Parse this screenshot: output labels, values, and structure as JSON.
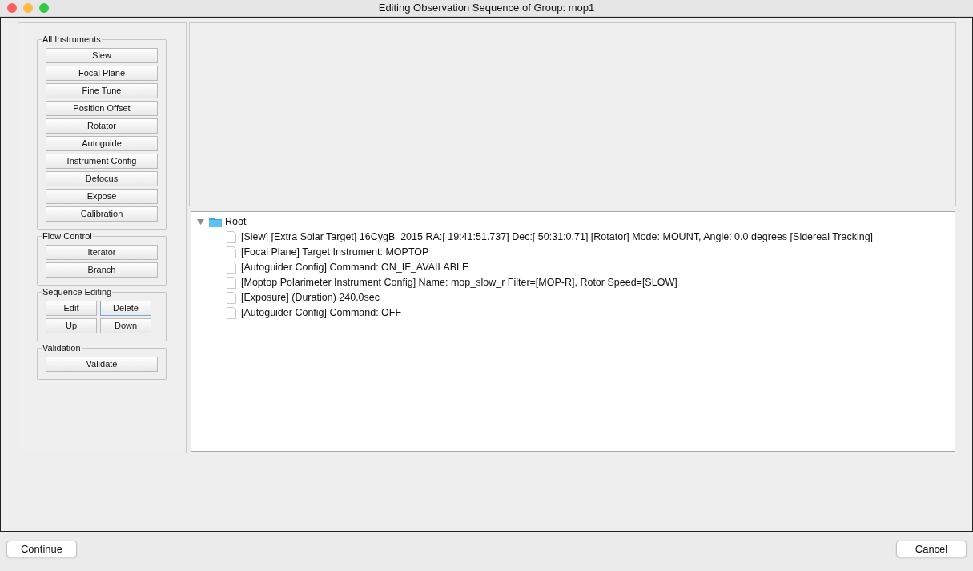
{
  "window": {
    "title": "Editing Observation Sequence of Group: mop1"
  },
  "groups": [
    {
      "title": "All Instruments",
      "kind": "list",
      "buttons": [
        {
          "label": "Slew",
          "focused": false
        },
        {
          "label": "Focal Plane",
          "focused": false
        },
        {
          "label": "Fine Tune",
          "focused": false
        },
        {
          "label": "Position Offset",
          "focused": false
        },
        {
          "label": "Rotator",
          "focused": false
        },
        {
          "label": "Autoguide",
          "focused": false
        },
        {
          "label": "Instrument Config",
          "focused": false
        },
        {
          "label": "Defocus",
          "focused": false
        },
        {
          "label": "Expose",
          "focused": false
        },
        {
          "label": "Calibration",
          "focused": false
        }
      ]
    },
    {
      "title": "Flow Control",
      "kind": "list",
      "buttons": [
        {
          "label": "Iterator",
          "focused": false
        },
        {
          "label": "Branch",
          "focused": false
        }
      ]
    },
    {
      "title": "Sequence Editing",
      "kind": "grid",
      "buttons": [
        {
          "label": "Edit",
          "focused": false
        },
        {
          "label": "Delete",
          "focused": true
        },
        {
          "label": "Up",
          "focused": false
        },
        {
          "label": "Down",
          "focused": false
        }
      ]
    },
    {
      "title": "Validation",
      "kind": "list",
      "buttons": [
        {
          "label": "Validate",
          "focused": false
        }
      ]
    }
  ],
  "tree": {
    "label": "Root",
    "expanded": true,
    "children": [
      {
        "label": "[Slew] [Extra Solar Target] 16CygB_2015 RA:[ 19:41:51.737] Dec:[ 50:31:0.71] [Rotator] Mode: MOUNT, Angle: 0.0 degrees [Sidereal Tracking]"
      },
      {
        "label": "[Focal Plane] Target Instrument: MOPTOP"
      },
      {
        "label": "[Autoguider Config] Command: ON_IF_AVAILABLE"
      },
      {
        "label": "[Moptop Polarimeter Instrument Config] Name: mop_slow_r Filter=[MOP-R], Rotor Speed=[SLOW]"
      },
      {
        "label": "[Exposure] (Duration) 240.0sec"
      },
      {
        "label": "[Autoguider Config] Command: OFF"
      }
    ]
  },
  "footer": {
    "buttons": [
      "Continue",
      "Cancel"
    ]
  }
}
